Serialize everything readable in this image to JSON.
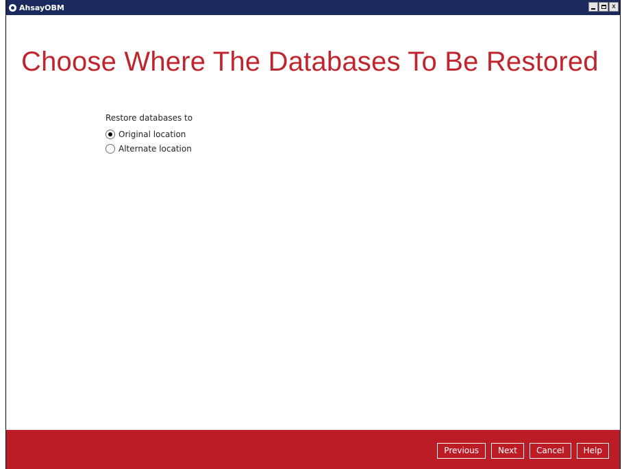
{
  "window": {
    "title": "AhsayOBM",
    "controls": {
      "minimize_icon": "minimize-icon",
      "maximize_icon": "maximize-icon",
      "close_label": "x"
    }
  },
  "page": {
    "title": "Choose Where The Databases To Be Restored"
  },
  "restore": {
    "label": "Restore databases to",
    "options": [
      {
        "label": "Original location",
        "selected": true
      },
      {
        "label": "Alternate location",
        "selected": false
      }
    ]
  },
  "footer": {
    "buttons": {
      "previous": "Previous",
      "next": "Next",
      "cancel": "Cancel",
      "help": "Help"
    }
  },
  "colors": {
    "titlebar": "#1a2a5e",
    "accent": "#bc1c26",
    "title_text": "#c0252e"
  }
}
